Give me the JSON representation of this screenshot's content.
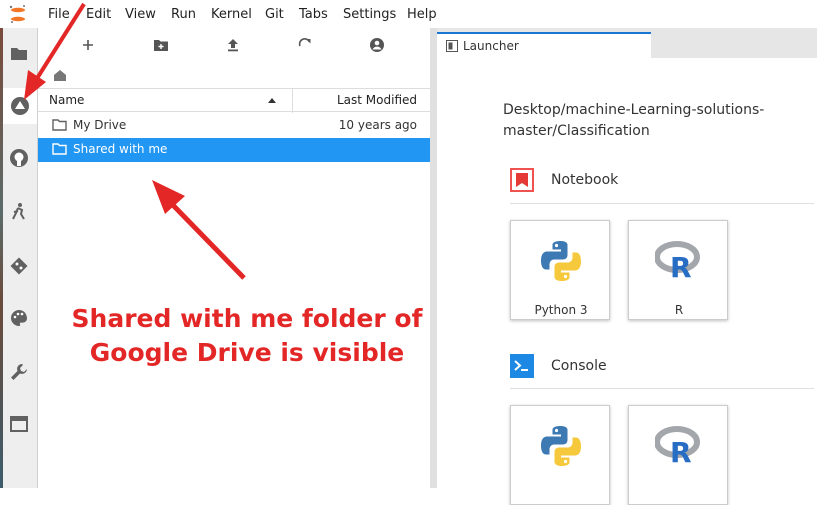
{
  "menu": [
    "File",
    "Edit",
    "View",
    "Run",
    "Kernel",
    "Git",
    "Tabs",
    "Settings",
    "Help"
  ],
  "sidebar_icons": [
    "folder-icon",
    "google-drive-icon",
    "github-icon",
    "running-icon",
    "git-icon",
    "palette-icon",
    "wrench-icon",
    "tabs-icon"
  ],
  "file_browser": {
    "toolbar": [
      "new-launcher-icon",
      "new-folder-icon",
      "upload-icon",
      "refresh-icon",
      "account-icon"
    ],
    "columns": {
      "name": "Name",
      "modified": "Last Modified"
    },
    "rows": [
      {
        "name": "My Drive",
        "modified": "10 years ago",
        "selected": false
      },
      {
        "name": "Shared with me",
        "modified": "",
        "selected": true
      }
    ]
  },
  "launcher": {
    "tab_label": "Launcher",
    "path": "Desktop/machine-Learning-solutions-master/Classification",
    "sections": [
      {
        "title": "Notebook",
        "icon": "notebook-icon",
        "cards": [
          "Python 3",
          "R"
        ]
      },
      {
        "title": "Console",
        "icon": "console-icon",
        "cards": [
          "",
          ""
        ]
      }
    ]
  },
  "annotation": {
    "line1": "Shared with me folder of",
    "line2": "Google Drive is visible",
    "color": "#e32726"
  },
  "colors": {
    "accent": "#2196f3",
    "brand_orange": "#f37626"
  }
}
